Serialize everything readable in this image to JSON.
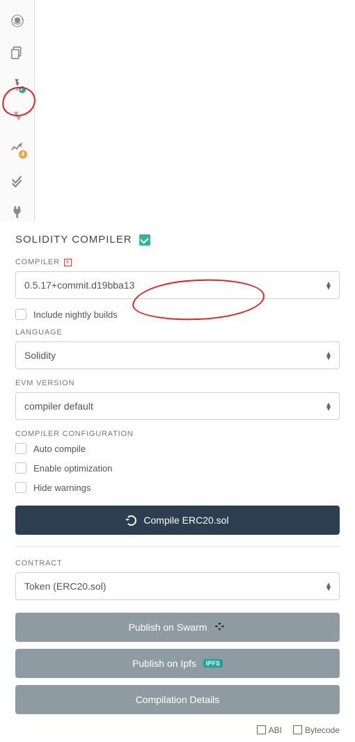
{
  "title": "SOLIDITY COMPILER",
  "sidebar": {
    "badge_count": "4"
  },
  "compiler": {
    "label": "COMPILER",
    "selected": "0.5.17+commit.d19bba13",
    "include_nightly": "Include nightly builds"
  },
  "language": {
    "label": "LANGUAGE",
    "selected": "Solidity"
  },
  "evm": {
    "label": "EVM VERSION",
    "selected": "compiler default"
  },
  "config": {
    "label": "COMPILER CONFIGURATION",
    "auto_compile": "Auto compile",
    "enable_optimization": "Enable optimization",
    "hide_warnings": "Hide warnings"
  },
  "compile_button": "Compile ERC20.sol",
  "contract": {
    "label": "CONTRACT",
    "selected": "Token (ERC20.sol)"
  },
  "buttons": {
    "swarm": "Publish on Swarm",
    "ipfs": "Publish on Ipfs",
    "details": "Compilation Details"
  },
  "footer": {
    "abi": "ABI",
    "bytecode": "Bytecode"
  }
}
